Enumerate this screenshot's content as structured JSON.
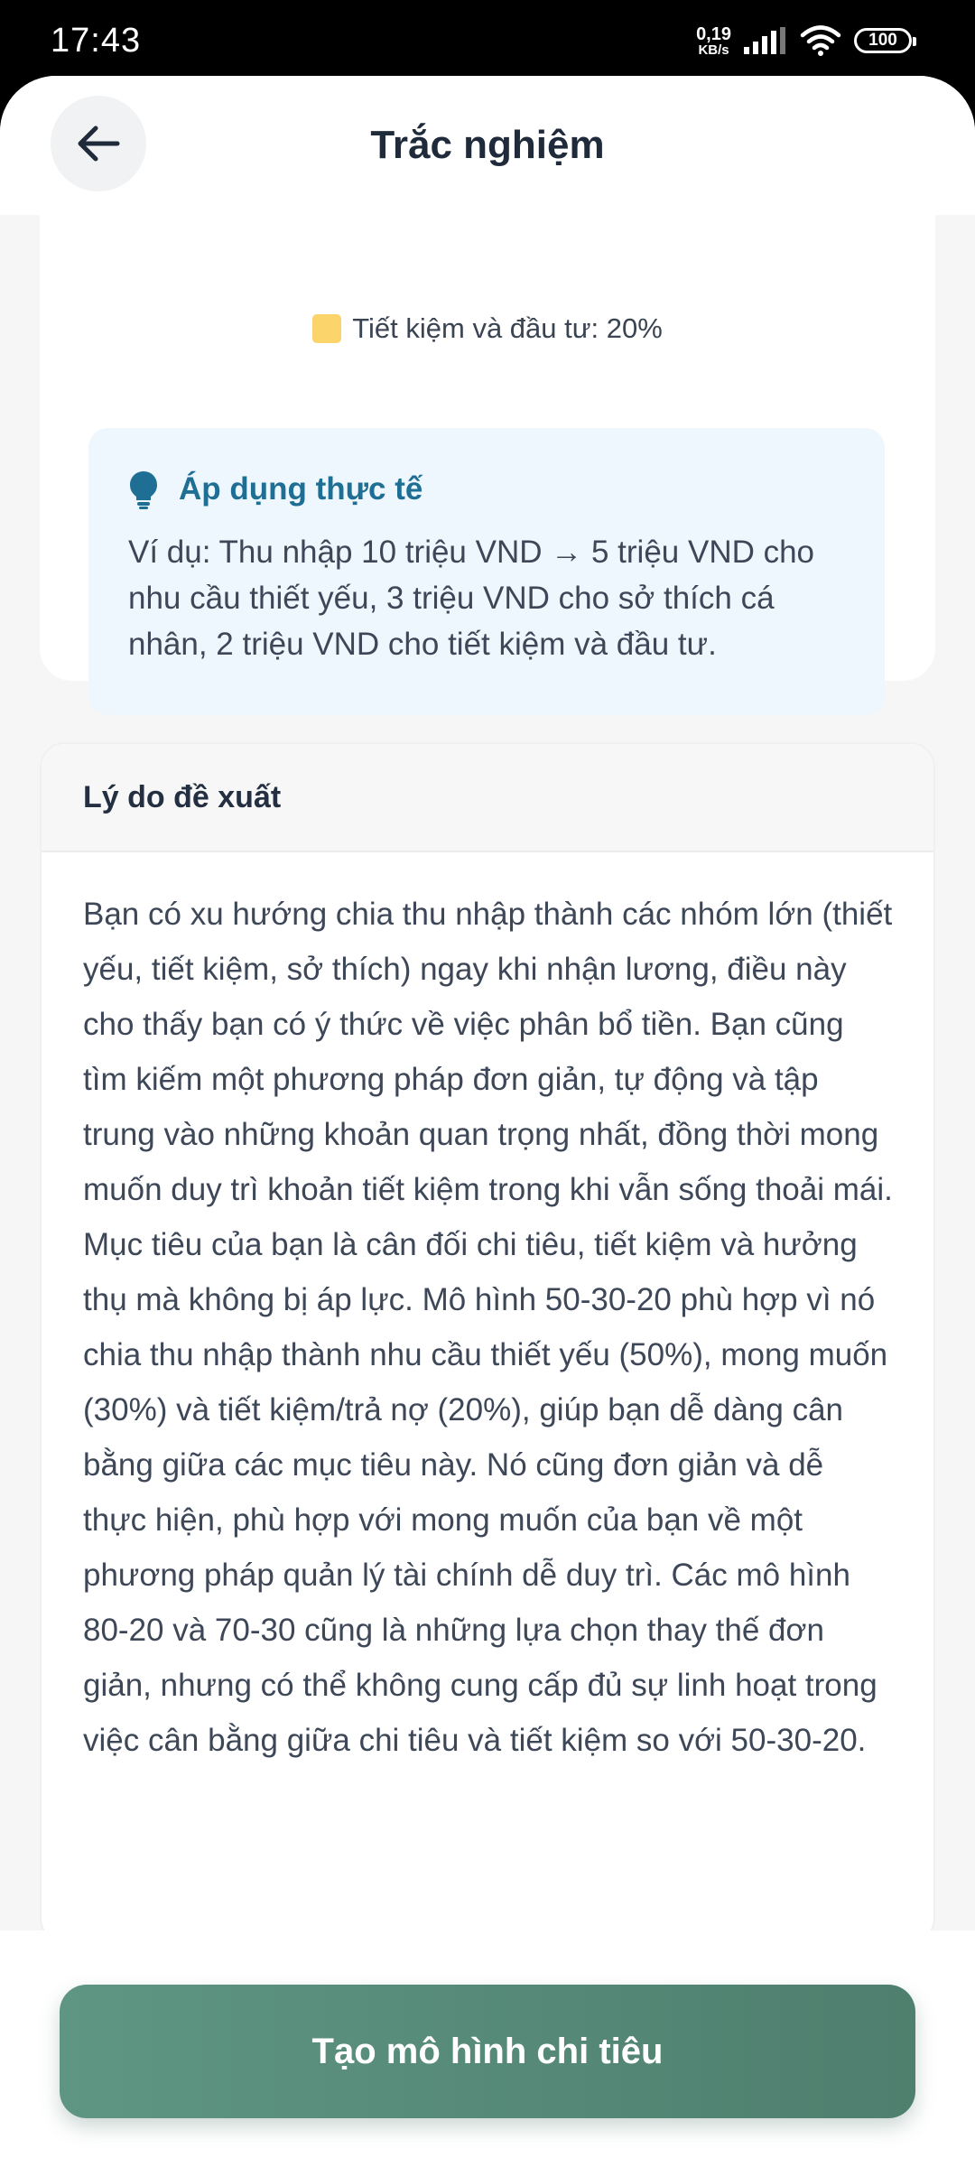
{
  "status_bar": {
    "time": "17:43",
    "net_speed_value": "0,19",
    "net_speed_unit": "KB/s",
    "battery": "100"
  },
  "header": {
    "title": "Trắc nghiệm",
    "back_icon": "arrow-left-icon"
  },
  "summary": {
    "legend_label": "Tiết kiệm và đầu tư: 20%",
    "legend_color": "#fbd46b",
    "tip": {
      "icon": "lightbulb-icon",
      "title": "Áp dụng thực tế",
      "text": "Ví dụ: Thu nhập 10 triệu VND → 5 triệu VND cho nhu cầu thiết yếu, 3 triệu VND cho sở thích cá nhân, 2 triệu VND cho tiết kiệm và đầu tư."
    }
  },
  "reason": {
    "title": "Lý do đề xuất",
    "body": "Bạn có xu hướng chia thu nhập thành các nhóm lớn (thiết yếu, tiết kiệm, sở thích) ngay khi nhận lương, điều này cho thấy bạn có ý thức về việc phân bổ tiền. Bạn cũng tìm kiếm một phương pháp đơn giản, tự động và tập trung vào những khoản quan trọng nhất, đồng thời mong muốn duy trì khoản tiết kiệm trong khi vẫn sống thoải mái. Mục tiêu của bạn là cân đối chi tiêu, tiết kiệm và hưởng thụ mà không bị áp lực. Mô hình 50-30-20 phù hợp vì nó chia thu nhập thành nhu cầu thiết yếu (50%), mong muốn (30%) và tiết kiệm/trả nợ (20%), giúp bạn dễ dàng cân bằng giữa các mục tiêu này. Nó cũng đơn giản và dễ thực hiện, phù hợp với mong muốn của bạn về một phương pháp quản lý tài chính dễ duy trì. Các mô hình 80-20 và 70-30 cũng là những lựa chọn thay thế đơn giản, nhưng có thể không cung cấp đủ sự linh hoạt trong việc cân bằng giữa chi tiêu và tiết kiệm so với 50-30-20."
  },
  "actions": {
    "create_button": "Tạo mô hình chi tiêu"
  },
  "colors": {
    "primary_green": "#5e9583",
    "tip_title": "#1f6f95",
    "tip_bg": "#eef7fd"
  }
}
